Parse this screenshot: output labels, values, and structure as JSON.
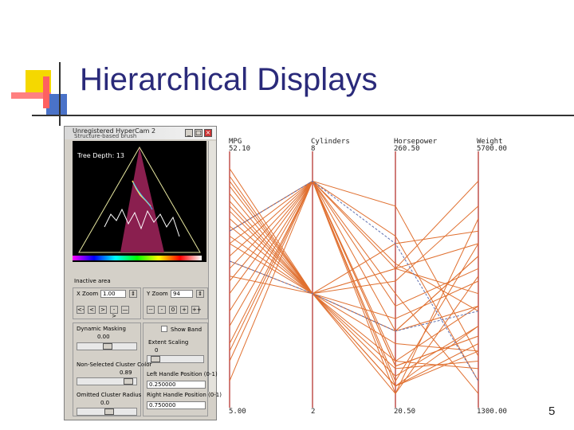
{
  "slide": {
    "title": "Hierarchical Displays",
    "number": "5",
    "accent_colors": [
      "#f5d800",
      "#ff6060",
      "#4a72c8",
      "#2a2a7a"
    ]
  },
  "window": {
    "title": "Unregistered HyperCam 2",
    "subtitle": "Structure-based brush",
    "buttons": [
      "_",
      "□",
      "×"
    ],
    "tree_depth_label": "Tree Depth: 13",
    "inactive_area_label": "Inactive area",
    "x_zoom_label": "X Zoom",
    "x_zoom_value": "1.00",
    "y_zoom_label": "Y Zoom",
    "y_zoom_value": "94",
    "left_nav_buttons": [
      "<-",
      "<",
      ">",
      "->",
      "—"
    ],
    "right_nav_buttons": [
      "--",
      "-",
      "0",
      "+",
      "++"
    ],
    "dynamic_masking_label": "Dynamic Masking",
    "dynamic_masking_value": "0.00",
    "show_band_label": "Show Band",
    "extent_scaling_label": "Extent Scaling",
    "extent_scaling_value": "0",
    "nonselected_label": "Non-Selected Cluster Color",
    "nonselected_value": "0.89",
    "omitted_radius_label": "Omitted Cluster Radius",
    "omitted_radius_value": "0.0",
    "left_handle_label": "Left Handle Position (0-1)",
    "left_handle_value": "0.250000",
    "right_handle_label": "Right Handle Position (0-1)",
    "right_handle_value": "0.750000"
  },
  "chart_data": {
    "type": "parallel-coordinates",
    "axes": [
      {
        "name": "MPG",
        "max": "52.10",
        "min": "5.00"
      },
      {
        "name": "Cylinders",
        "max": "8",
        "min": "2"
      },
      {
        "name": "Horsepower",
        "max": "260.50",
        "min": "20.50"
      },
      {
        "name": "Weight",
        "max": "5700.00",
        "min": "1300.00"
      }
    ],
    "line_color": "#e07030",
    "axis_color": "#c0504d",
    "lines": [
      [
        0.3,
        0.1,
        0.55,
        0.95
      ],
      [
        0.3,
        0.1,
        0.43,
        0.62
      ],
      [
        0.35,
        0.1,
        0.32,
        0.9
      ],
      [
        0.4,
        0.1,
        0.2,
        0.8
      ],
      [
        0.45,
        0.1,
        0.7,
        0.6
      ],
      [
        0.55,
        0.1,
        0.82,
        0.85
      ],
      [
        0.62,
        0.1,
        0.6,
        0.45
      ],
      [
        0.68,
        0.1,
        0.45,
        0.55
      ],
      [
        0.75,
        0.1,
        0.84,
        0.72
      ],
      [
        0.78,
        0.1,
        0.84,
        0.72
      ],
      [
        0.82,
        0.1,
        0.9,
        0.35
      ],
      [
        0.9,
        0.1,
        0.95,
        0.25
      ],
      [
        0.5,
        0.1,
        0.92,
        0.68
      ],
      [
        0.25,
        0.55,
        0.85,
        0.82
      ],
      [
        0.22,
        0.55,
        0.75,
        0.78
      ],
      [
        0.2,
        0.55,
        0.82,
        0.6
      ],
      [
        0.18,
        0.55,
        0.65,
        0.5
      ],
      [
        0.15,
        0.55,
        0.7,
        0.4
      ],
      [
        0.12,
        0.55,
        0.45,
        0.35
      ],
      [
        0.1,
        0.55,
        0.35,
        0.3
      ],
      [
        0.08,
        0.55,
        0.5,
        0.2
      ],
      [
        0.05,
        0.55,
        0.45,
        0.1
      ],
      [
        0.28,
        0.55,
        0.92,
        0.75
      ],
      [
        0.32,
        0.55,
        0.95,
        0.48
      ],
      [
        0.35,
        0.55,
        0.7,
        0.4
      ],
      [
        0.42,
        0.55,
        0.88,
        0.68
      ],
      [
        0.48,
        0.55,
        0.92,
        0.78
      ]
    ],
    "highlight_lines": [
      [
        0.3,
        0.1,
        0.35,
        0.9
      ],
      [
        0.42,
        0.55,
        0.7,
        0.62
      ]
    ]
  }
}
